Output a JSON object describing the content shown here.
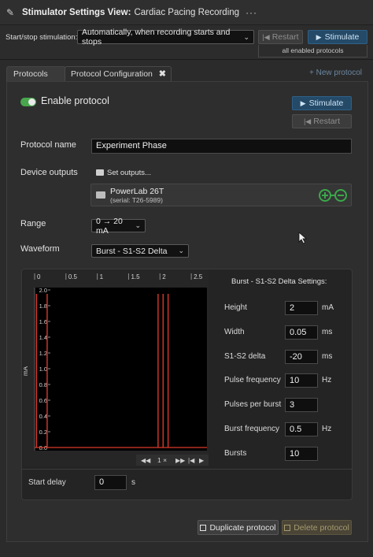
{
  "window": {
    "title": "Stimulator Settings View:",
    "subtitle": "Cardiac Pacing Recording",
    "more": "···"
  },
  "stim_bar": {
    "label": "Start/stop stimulation:",
    "mode_value": "Automatically, when recording starts and stops",
    "restart_label": "Restart",
    "stimulate_label": "Stimulate",
    "note": "all enabled protocols"
  },
  "tabs": [
    {
      "label": "Protocols"
    },
    {
      "label": "Protocol Configuration",
      "close": "✖"
    }
  ],
  "new_protocol_label": "+ New protocol",
  "protocol": {
    "enable_label": "Enable protocol",
    "enabled": true,
    "stimulate_label": "Stimulate",
    "restart_label": "Restart",
    "name_label": "Protocol name",
    "name_value": "Experiment Phase",
    "device_outputs_label": "Device outputs",
    "set_outputs_label": "Set outputs...",
    "device_name": "PowerLab 26T",
    "device_serial": "(serial: T26-5989)",
    "range_label": "Range",
    "range_value": "0 → 20 mA",
    "waveform_label": "Waveform",
    "waveform_value": "Burst - S1-S2 Delta"
  },
  "chart_data": {
    "type": "line",
    "ylabel": "mA",
    "x_ticks": [
      "0",
      "0.5",
      "1",
      "1.5",
      "2",
      "2.5"
    ],
    "y_ticks": [
      "0.0",
      "0.2",
      "0.4",
      "0.6",
      "0.8",
      "1.0",
      "1.2",
      "1.4",
      "1.6",
      "1.8",
      "2.0"
    ],
    "xlim": [
      0,
      2.75
    ],
    "ylim": [
      0,
      2.0
    ],
    "pulse_height": 1.95,
    "pulse_times": [
      0.03,
      0.2,
      1.97,
      2.05,
      2.13
    ],
    "pulse_color": "#d93a2b",
    "playback": {
      "zoom": "1 ×"
    }
  },
  "settings": {
    "title": "Burst - S1-S2 Delta Settings:",
    "fields": [
      {
        "label": "Height",
        "value": "2",
        "unit": "mA"
      },
      {
        "label": "Width",
        "value": "0.05",
        "unit": "ms"
      },
      {
        "label": "S1-S2 delta",
        "value": "-20",
        "unit": "ms"
      },
      {
        "label": "Pulse frequency",
        "value": "10",
        "unit": "Hz"
      },
      {
        "label": "Pulses per burst",
        "value": "3",
        "unit": ""
      },
      {
        "label": "Burst frequency",
        "value": "0.5",
        "unit": "Hz"
      },
      {
        "label": "Bursts",
        "value": "10",
        "unit": ""
      }
    ]
  },
  "start_delay": {
    "label": "Start delay",
    "value": "0",
    "unit": "s"
  },
  "actions": {
    "duplicate_label": "Duplicate protocol",
    "delete_label": "Delete protocol"
  },
  "colors": {
    "accent_blue": "#244a68",
    "toggle_green": "#48a64c",
    "device_green": "#3aa84a"
  }
}
